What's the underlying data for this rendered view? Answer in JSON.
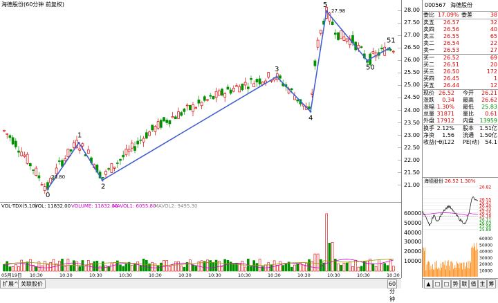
{
  "chart": {
    "title": "海德股份(60分钟 前复权)",
    "wave_labels": [
      "0",
      "1",
      "2",
      "3",
      "4",
      "5",
      "50",
      "51"
    ],
    "annotations": {
      "low": "20.80",
      "high": "27.98"
    },
    "price_ticks": [
      "28.00",
      "27.50",
      "27.00",
      "26.50",
      "26.00",
      "25.50",
      "25.00",
      "24.50",
      "24.00",
      "23.50",
      "23.00",
      "22.50",
      "22.00",
      "21.50",
      "21.00"
    ],
    "time_ticks": [
      "05月19日",
      "10:30",
      "10:30",
      "10:30",
      "10:30",
      "10:30",
      "10:30",
      "10:30",
      "10:30",
      "10:30",
      "10:30",
      "10:30",
      "10:30",
      "10:30"
    ],
    "colors": {
      "up": "#e00000",
      "down": "#009000",
      "wave": "#4060d0"
    }
  },
  "volume": {
    "indicator": "VOL-TDX(5,10)",
    "vol_label": "VOL: 11832.00",
    "volume_label": "VOLUME: 11832.00",
    "mavol1_label": "MAVOL1: 6055.80",
    "mavol2_label": "MAVOL2: 9495.30",
    "ticks": [
      "60000",
      "50000",
      "40000",
      "30000",
      "20000",
      "10000"
    ],
    "unit_label": "60分钟"
  },
  "bottom_tabs": [
    "扩展^",
    "关联股价"
  ],
  "quote": {
    "code": "000567",
    "name": "海德股份",
    "weibi_label": "委比",
    "weibi_value": "17.09%",
    "weicha_label": "委差",
    "weicha_value": "38",
    "asks": [
      {
        "label": "卖五",
        "price": "26.57",
        "vol": "32"
      },
      {
        "label": "卖四",
        "price": "26.56",
        "vol": "40"
      },
      {
        "label": "卖三",
        "price": "26.55",
        "vol": "65"
      },
      {
        "label": "卖二",
        "price": "26.54",
        "vol": "22"
      },
      {
        "label": "卖一",
        "price": "26.53",
        "vol": "27"
      }
    ],
    "bids": [
      {
        "label": "买一",
        "price": "26.52",
        "vol": "69"
      },
      {
        "label": "买二",
        "price": "26.51",
        "vol": "20"
      },
      {
        "label": "买三",
        "price": "26.50",
        "vol": "172"
      },
      {
        "label": "买四",
        "price": "26.45",
        "vol": "1"
      },
      {
        "label": "买五",
        "price": "26.44",
        "vol": "12"
      }
    ],
    "stats": [
      {
        "l1": "现价",
        "v1": "26.52",
        "l2": "今开",
        "v2": "26.21"
      },
      {
        "l1": "涨跌",
        "v1": "0.34",
        "l2": "最高",
        "v2": "26.62"
      },
      {
        "l1": "涨幅",
        "v1": "1.30%",
        "l2": "最低",
        "v2": "25.83"
      },
      {
        "l1": "总量",
        "v1": "31871",
        "l2": "量比",
        "v2": "0.61"
      },
      {
        "l1": "外盘",
        "v1": "17912",
        "l2": "内盘",
        "v2": "13959"
      }
    ],
    "stats2": [
      {
        "l1": "换手",
        "v1": "2.12%",
        "l2": "股本",
        "v2": "1.51亿"
      },
      {
        "l1": "净资",
        "v1": "1.56",
        "l2": "流通",
        "v2": "1.50亿"
      },
      {
        "l1": "收益(一)",
        "v1": "0.122",
        "l2": "PE(动)",
        "v2": "54.1"
      }
    ]
  },
  "mini": {
    "title": "海德股份",
    "quote": "26.52 1.30%",
    "price_ticks": [
      "26.82",
      "26.55",
      "26.47",
      "26.40",
      "26.33",
      "26.25",
      "26.18",
      "26.11",
      "26.03",
      "25.96",
      "25.89"
    ],
    "vol_ticks": [
      "60000",
      "50000",
      "40000",
      "30000",
      "20000",
      "10000"
    ],
    "tabs": [
      "▲",
      "□",
      "□",
      "势",
      "联",
      "值",
      "主",
      "筹"
    ]
  }
}
